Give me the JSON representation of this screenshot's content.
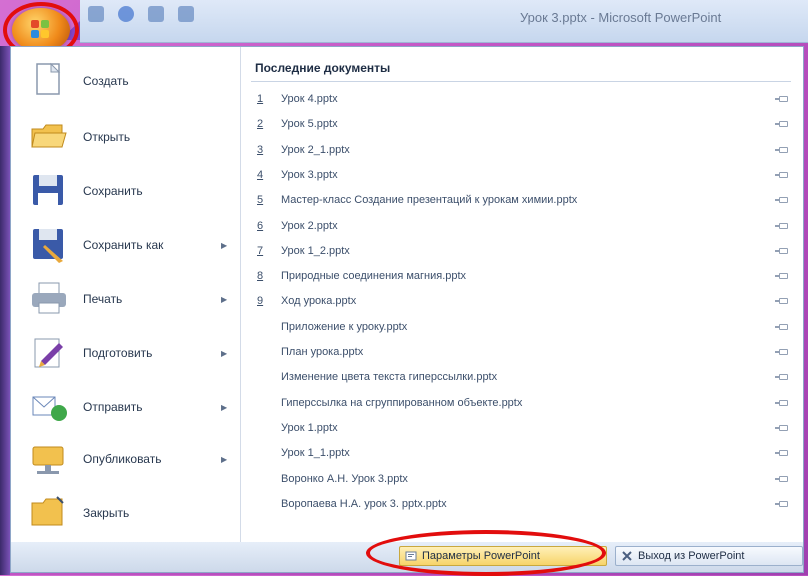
{
  "window": {
    "title": "Урок 3.pptx - Microsoft PowerPoint"
  },
  "left_menu": [
    {
      "label": "Создать",
      "icon": "new-document-icon",
      "has_arrow": false
    },
    {
      "label": "Открыть",
      "icon": "open-folder-icon",
      "has_arrow": false
    },
    {
      "label": "Сохранить",
      "icon": "save-floppy-icon",
      "has_arrow": false
    },
    {
      "label": "Сохранить как",
      "icon": "save-as-icon",
      "has_arrow": true
    },
    {
      "label": "Печать",
      "icon": "printer-icon",
      "has_arrow": true
    },
    {
      "label": "Подготовить",
      "icon": "prepare-pen-icon",
      "has_arrow": true
    },
    {
      "label": "Отправить",
      "icon": "send-icon",
      "has_arrow": true
    },
    {
      "label": "Опубликовать",
      "icon": "publish-icon",
      "has_arrow": true
    },
    {
      "label": "Закрыть",
      "icon": "close-folder-icon",
      "has_arrow": false
    }
  ],
  "recent": {
    "title": "Последние документы",
    "items": [
      {
        "num": "1",
        "name": "Урок 4.pptx"
      },
      {
        "num": "2",
        "name": "Урок 5.pptx"
      },
      {
        "num": "3",
        "name": "Урок 2_1.pptx"
      },
      {
        "num": "4",
        "name": "Урок 3.pptx"
      },
      {
        "num": "5",
        "name": "Мастер-класс Создание презентаций к урокам химии.pptx"
      },
      {
        "num": "6",
        "name": "Урок 2.pptx"
      },
      {
        "num": "7",
        "name": "Урок 1_2.pptx"
      },
      {
        "num": "8",
        "name": "Природные соединения магния.pptx"
      },
      {
        "num": "9",
        "name": "Ход урока.pptx"
      },
      {
        "num": "",
        "name": "Приложение к уроку.pptx"
      },
      {
        "num": "",
        "name": "План урока.pptx"
      },
      {
        "num": "",
        "name": "Изменение цвета текста гиперссылки.pptx"
      },
      {
        "num": "",
        "name": "Гиперссылка на сгруппированном объекте.pptx"
      },
      {
        "num": "",
        "name": "Урок 1.pptx"
      },
      {
        "num": "",
        "name": "Урок 1_1.pptx"
      },
      {
        "num": "",
        "name": "Воронко А.Н. Урок 3.pptx"
      },
      {
        "num": "",
        "name": "Воропаева Н.А. урок 3. pptx.pptx"
      }
    ]
  },
  "bottom": {
    "options_label": "Параметры PowerPoint",
    "exit_label": "Выход из PowerPoint"
  },
  "colors": {
    "highlight_ring": "#e20d0d",
    "slide_bg": "#c255c4",
    "accent": "#f08a1a"
  }
}
